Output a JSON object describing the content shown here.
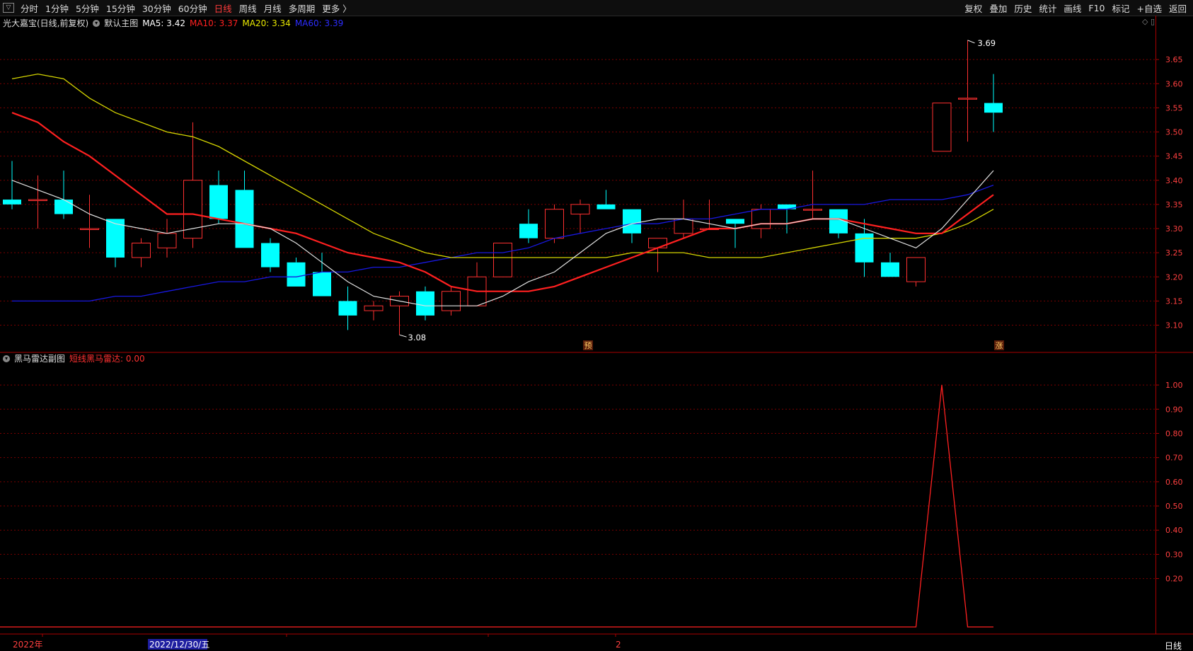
{
  "toolbar": {
    "left_items": [
      "分时",
      "1分钟",
      "5分钟",
      "15分钟",
      "30分钟",
      "60分钟",
      "日线",
      "周线",
      "月线",
      "多周期",
      "更多 〉"
    ],
    "active": "日线",
    "right_items": [
      "复权",
      "叠加",
      "历史",
      "统计",
      "画线",
      "F10",
      "标记",
      "+自选",
      "返回"
    ]
  },
  "main_pane": {
    "stock_name": "光大嘉宝(日线,前复权)",
    "template": "默认主图",
    "ma": [
      {
        "label": "MA5: 3.42",
        "color": "#ffffff"
      },
      {
        "label": "MA10: 3.37",
        "color": "#ff2020"
      },
      {
        "label": "MA20: 3.34",
        "color": "#e8e800"
      },
      {
        "label": "MA60: 3.39",
        "color": "#2020ff"
      }
    ],
    "high_label": "3.69",
    "low_label": "3.08",
    "marker_yu": "预",
    "marker_zhang": "涨"
  },
  "sub_pane": {
    "title": "黑马雷达副图",
    "indicator": "短线黑马雷达: 0.00"
  },
  "bottom": {
    "year_label": "2022年",
    "date_cursor": "2022/12/30/五",
    "month_label": "2",
    "period_label": "日线"
  },
  "colors": {
    "up": "#ff3030",
    "down": "#00ffff",
    "grid": "#7a0000",
    "axis": "#aa0000"
  },
  "chart_data": [
    {
      "type": "candlestick",
      "y_ticks": [
        3.1,
        3.15,
        3.2,
        3.25,
        3.3,
        3.35,
        3.4,
        3.45,
        3.5,
        3.55,
        3.6,
        3.65
      ],
      "ylim": [
        3.07,
        3.7
      ],
      "candles": [
        {
          "o": 3.36,
          "h": 3.44,
          "l": 3.34,
          "c": 3.35
        },
        {
          "o": 3.36,
          "h": 3.41,
          "l": 3.3,
          "c": 3.36
        },
        {
          "o": 3.36,
          "h": 3.42,
          "l": 3.32,
          "c": 3.33
        },
        {
          "o": 3.3,
          "h": 3.37,
          "l": 3.26,
          "c": 3.3
        },
        {
          "o": 3.32,
          "h": 3.32,
          "l": 3.22,
          "c": 3.24
        },
        {
          "o": 3.24,
          "h": 3.28,
          "l": 3.22,
          "c": 3.27
        },
        {
          "o": 3.26,
          "h": 3.32,
          "l": 3.24,
          "c": 3.29
        },
        {
          "o": 3.28,
          "h": 3.52,
          "l": 3.26,
          "c": 3.4
        },
        {
          "o": 3.39,
          "h": 3.42,
          "l": 3.31,
          "c": 3.32
        },
        {
          "o": 3.38,
          "h": 3.42,
          "l": 3.26,
          "c": 3.26
        },
        {
          "o": 3.27,
          "h": 3.28,
          "l": 3.21,
          "c": 3.22
        },
        {
          "o": 3.23,
          "h": 3.24,
          "l": 3.18,
          "c": 3.18
        },
        {
          "o": 3.21,
          "h": 3.25,
          "l": 3.16,
          "c": 3.16
        },
        {
          "o": 3.15,
          "h": 3.18,
          "l": 3.09,
          "c": 3.12
        },
        {
          "o": 3.13,
          "h": 3.15,
          "l": 3.11,
          "c": 3.14
        },
        {
          "o": 3.14,
          "h": 3.17,
          "l": 3.08,
          "c": 3.16
        },
        {
          "o": 3.17,
          "h": 3.18,
          "l": 3.11,
          "c": 3.12
        },
        {
          "o": 3.13,
          "h": 3.18,
          "l": 3.12,
          "c": 3.17
        },
        {
          "o": 3.14,
          "h": 3.23,
          "l": 3.14,
          "c": 3.2
        },
        {
          "o": 3.2,
          "h": 3.27,
          "l": 3.2,
          "c": 3.27
        },
        {
          "o": 3.31,
          "h": 3.34,
          "l": 3.27,
          "c": 3.28
        },
        {
          "o": 3.28,
          "h": 3.35,
          "l": 3.27,
          "c": 3.34
        },
        {
          "o": 3.33,
          "h": 3.36,
          "l": 3.29,
          "c": 3.35
        },
        {
          "o": 3.35,
          "h": 3.38,
          "l": 3.34,
          "c": 3.34
        },
        {
          "o": 3.34,
          "h": 3.34,
          "l": 3.27,
          "c": 3.29
        },
        {
          "o": 3.26,
          "h": 3.28,
          "l": 3.21,
          "c": 3.28
        },
        {
          "o": 3.29,
          "h": 3.36,
          "l": 3.28,
          "c": 3.32
        },
        {
          "o": 3.3,
          "h": 3.36,
          "l": 3.3,
          "c": 3.3
        },
        {
          "o": 3.32,
          "h": 3.32,
          "l": 3.26,
          "c": 3.31
        },
        {
          "o": 3.3,
          "h": 3.35,
          "l": 3.28,
          "c": 3.34
        },
        {
          "o": 3.35,
          "h": 3.35,
          "l": 3.29,
          "c": 3.34
        },
        {
          "o": 3.34,
          "h": 3.42,
          "l": 3.32,
          "c": 3.34
        },
        {
          "o": 3.34,
          "h": 3.34,
          "l": 3.28,
          "c": 3.29
        },
        {
          "o": 3.29,
          "h": 3.32,
          "l": 3.2,
          "c": 3.23
        },
        {
          "o": 3.23,
          "h": 3.25,
          "l": 3.2,
          "c": 3.2
        },
        {
          "o": 3.19,
          "h": 3.24,
          "l": 3.18,
          "c": 3.24
        },
        {
          "o": 3.46,
          "h": 3.56,
          "l": 3.46,
          "c": 3.56
        },
        {
          "o": 3.57,
          "h": 3.69,
          "l": 3.48,
          "c": 3.57
        },
        {
          "o": 3.56,
          "h": 3.62,
          "l": 3.5,
          "c": 3.54
        }
      ],
      "ma5": [
        3.4,
        3.38,
        3.36,
        3.33,
        3.31,
        3.3,
        3.29,
        3.3,
        3.31,
        3.31,
        3.3,
        3.27,
        3.23,
        3.19,
        3.16,
        3.15,
        3.14,
        3.14,
        3.14,
        3.16,
        3.19,
        3.21,
        3.25,
        3.29,
        3.31,
        3.32,
        3.32,
        3.31,
        3.3,
        3.31,
        3.31,
        3.32,
        3.32,
        3.3,
        3.28,
        3.26,
        3.3,
        3.36,
        3.42
      ],
      "ma10": [
        3.54,
        3.52,
        3.48,
        3.45,
        3.41,
        3.37,
        3.33,
        3.33,
        3.32,
        3.31,
        3.3,
        3.29,
        3.27,
        3.25,
        3.24,
        3.23,
        3.21,
        3.18,
        3.17,
        3.17,
        3.17,
        3.18,
        3.2,
        3.22,
        3.24,
        3.26,
        3.28,
        3.3,
        3.3,
        3.31,
        3.31,
        3.32,
        3.32,
        3.31,
        3.3,
        3.29,
        3.29,
        3.33,
        3.37
      ],
      "ma20": [
        3.61,
        3.62,
        3.61,
        3.57,
        3.54,
        3.52,
        3.5,
        3.49,
        3.47,
        3.44,
        3.41,
        3.38,
        3.35,
        3.32,
        3.29,
        3.27,
        3.25,
        3.24,
        3.24,
        3.24,
        3.24,
        3.24,
        3.24,
        3.24,
        3.25,
        3.25,
        3.25,
        3.24,
        3.24,
        3.24,
        3.25,
        3.26,
        3.27,
        3.28,
        3.28,
        3.28,
        3.29,
        3.31,
        3.34
      ],
      "ma60": [
        3.15,
        3.15,
        3.15,
        3.15,
        3.16,
        3.16,
        3.17,
        3.18,
        3.19,
        3.19,
        3.2,
        3.2,
        3.21,
        3.21,
        3.22,
        3.22,
        3.23,
        3.24,
        3.25,
        3.25,
        3.26,
        3.28,
        3.29,
        3.3,
        3.31,
        3.31,
        3.32,
        3.32,
        3.33,
        3.34,
        3.34,
        3.35,
        3.35,
        3.35,
        3.36,
        3.36,
        3.36,
        3.37,
        3.39
      ]
    },
    {
      "type": "line",
      "title": "短线黑马雷达",
      "y_ticks": [
        0.2,
        0.3,
        0.4,
        0.5,
        0.6,
        0.7,
        0.8,
        0.9,
        1.0
      ],
      "ylim": [
        0,
        1.05
      ],
      "values": [
        0,
        0,
        0,
        0,
        0,
        0,
        0,
        0,
        0,
        0,
        0,
        0,
        0,
        0,
        0,
        0,
        0,
        0,
        0,
        0,
        0,
        0,
        0,
        0,
        0,
        0,
        0,
        0,
        0,
        0,
        0,
        0,
        0,
        0,
        0,
        0,
        1,
        0,
        0
      ]
    }
  ]
}
